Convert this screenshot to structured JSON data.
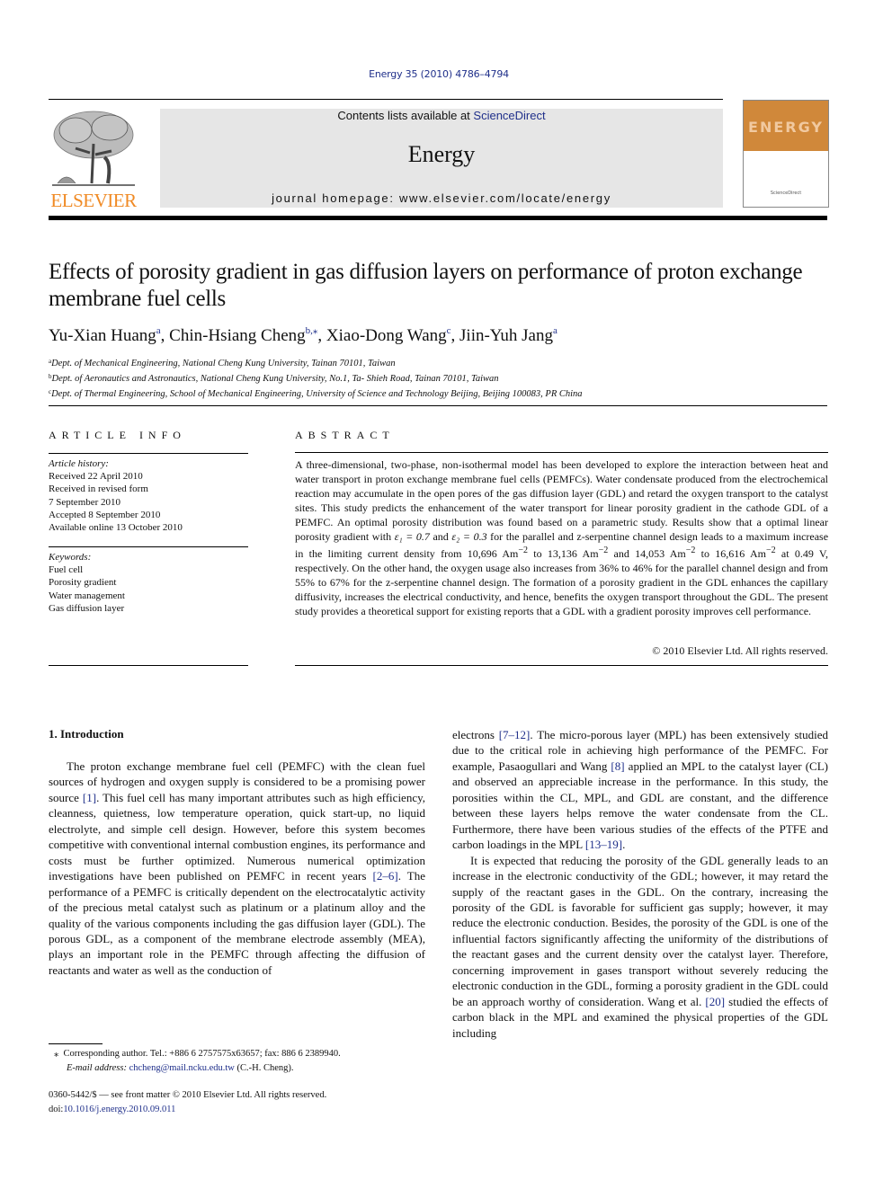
{
  "header": {
    "citation": "Energy 35 (2010) 4786–4794",
    "publisher_logo_text": "ELSEVIER",
    "contents_prefix": "Contents lists available at ",
    "contents_link": "ScienceDirect",
    "journal_name": "Energy",
    "homepage": "journal homepage: www.elsevier.com/locate/energy",
    "cover_title": "ENERGY",
    "colors": {
      "link": "#1f2f8a",
      "elsevier_orange": "#f08a24",
      "cover_orange": "#d0883a",
      "banner_gray": "#e6e6e6"
    }
  },
  "article": {
    "title": "Effects of porosity gradient in gas diffusion layers on performance of proton exchange membrane fuel cells",
    "authors": [
      {
        "name": "Yu-Xian Huang",
        "sup": "a",
        "sep": ", "
      },
      {
        "name": "Chin-Hsiang Cheng",
        "sup": "b,⁎",
        "sep": ", "
      },
      {
        "name": "Xiao-Dong Wang",
        "sup": "c",
        "sep": ", "
      },
      {
        "name": "Jiin-Yuh Jang",
        "sup": "a",
        "sep": ""
      }
    ],
    "affiliations": [
      {
        "mark": "a",
        "text": "Dept. of Mechanical Engineering, National Cheng Kung University, Tainan 70101, Taiwan"
      },
      {
        "mark": "b",
        "text": "Dept. of Aeronautics and Astronautics, National Cheng Kung University, No.1, Ta- Shieh Road, Tainan 70101, Taiwan"
      },
      {
        "mark": "c",
        "text": "Dept. of Thermal Engineering, School of Mechanical Engineering, University of Science and Technology Beijing, Beijing 100083, PR China"
      }
    ]
  },
  "article_info": {
    "heading": "ARTICLE INFO",
    "history_label": "Article history:",
    "history": [
      "Received 22 April 2010",
      "Received in revised form",
      "7 September 2010",
      "Accepted 8 September 2010",
      "Available online 13 October 2010"
    ],
    "keywords_label": "Keywords:",
    "keywords": [
      "Fuel cell",
      "Porosity gradient",
      "Water management",
      "Gas diffusion layer"
    ]
  },
  "abstract": {
    "heading": "ABSTRACT",
    "text_1": "A three-dimensional, two-phase, non-isothermal model has been developed to explore the interaction between heat and water transport in proton exchange membrane fuel cells (PEMFCs). Water condensate produced from the electrochemical reaction may accumulate in the open pores of the gas diffusion layer (GDL) and retard the oxygen transport to the catalyst sites. This study predicts the enhancement of the water transport for linear porosity gradient in the cathode GDL of a PEMFC. An optimal porosity distribution was found based on a parametric study. Results show that a optimal linear porosity gradient with ",
    "eps1": "ε₁ = 0.7",
    "and_word": " and ",
    "eps2": "ε₂ = 0.3",
    "text_2": " for the parallel and z-serpentine channel design leads to a maximum increase in the limiting current density from 10,696 Am",
    "unit_exp": "−2",
    "v1_to": " to 13,136 Am",
    "v2": " and 14,053 Am",
    "v3_to": " to 16,616 Am",
    "text_3": " at 0.49 V, respectively. On the other hand, the oxygen usage also increases from 36% to 46% for the parallel channel design and from 55% to 67% for the z-serpentine channel design. The formation of a porosity gradient in the GDL enhances the capillary diffusivity, increases the electrical conductivity, and hence, benefits the oxygen transport throughout the GDL. The present study provides a theoretical support for existing reports that a GDL with a gradient porosity improves cell performance.",
    "copyright": "© 2010 Elsevier Ltd. All rights reserved."
  },
  "body": {
    "section_heading": "1.  Introduction",
    "left_p1_a": "The proton exchange membrane fuel cell (PEMFC) with the clean fuel sources of hydrogen and oxygen supply is considered to be a promising power source ",
    "ref_1": "[1]",
    "left_p1_b": ". This fuel cell has many important attributes such as high efficiency, cleanness, quietness, low temperature operation, quick start-up, no liquid electrolyte, and simple cell design. However, before this system becomes competitive with conventional internal combustion engines, its performance and costs must be further optimized. Numerous numerical optimization investigations have been published on PEMFC in recent years ",
    "ref_2_6": "[2–6]",
    "left_p1_c": ". The performance of a PEMFC is critically dependent on the electrocatalytic activity of the precious metal catalyst such as platinum or a platinum alloy and the quality of the various components including the gas diffusion layer (GDL). The porous GDL, as a component of the membrane electrode assembly (MEA), plays an important role in the PEMFC through affecting the diffusion of reactants and water as well as the conduction of",
    "right_p1_a": "electrons ",
    "ref_7_12": "[7–12]",
    "right_p1_b": ". The micro-porous layer (MPL) has been extensively studied due to the critical role in achieving high performance of the PEMFC. For example, Pasaogullari and Wang ",
    "ref_8": "[8]",
    "right_p1_c": " applied an MPL to the catalyst layer (CL) and observed an appreciable increase in the performance. In this study, the porosities within the CL, MPL, and GDL are constant, and the difference between these layers helps remove the water condensate from the CL. Furthermore, there have been various studies of the effects of the PTFE and carbon loadings in the MPL ",
    "ref_13_19": "[13–19]",
    "right_p1_d": ".",
    "right_p2_a": "It is expected that reducing the porosity of the GDL generally leads to an increase in the electronic conductivity of the GDL; however, it may retard the supply of the reactant gases in the GDL. On the contrary, increasing the porosity of the GDL is favorable for sufficient gas supply; however, it may reduce the electronic conduction. Besides, the porosity of the GDL is one of the influential factors significantly affecting the uniformity of the distributions of the reactant gases and the current density over the catalyst layer. Therefore, concerning improvement in gases transport without severely reducing the electronic conduction in the GDL, forming a porosity gradient in the GDL could be an approach worthy of consideration. Wang et al. ",
    "ref_20": "[20]",
    "right_p2_b": " studied the effects of carbon black in the MPL and examined the physical properties of the GDL including"
  },
  "footnotes": {
    "star": "⁎",
    "corresponding": "Corresponding author. Tel.: +886 6 2757575x63657; fax: 886 6 2389940.",
    "email_label": "E-mail address:",
    "email": "chcheng@mail.ncku.edu.tw",
    "email_suffix": " (C.-H. Cheng).",
    "front_matter": "0360-5442/$ — see front matter © 2010 Elsevier Ltd. All rights reserved.",
    "doi_label": "doi:",
    "doi": "10.1016/j.energy.2010.09.011"
  }
}
